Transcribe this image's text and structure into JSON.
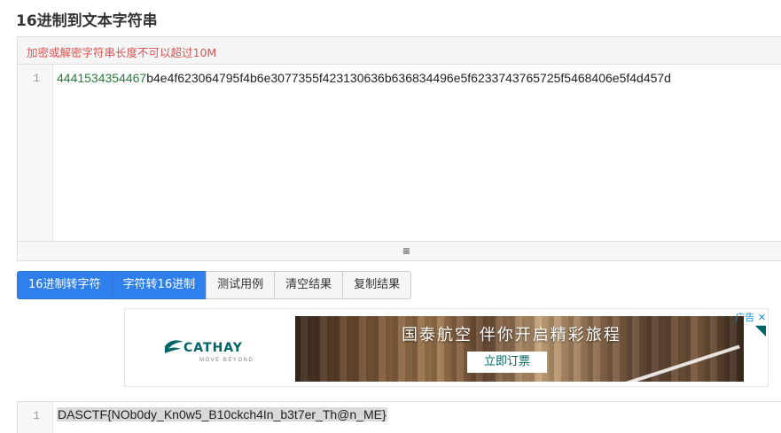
{
  "page": {
    "title": "16进制到文本字符串"
  },
  "editor": {
    "hint": "加密或解密字符串长度不可以超过10M",
    "line_number": "1",
    "input_value_numeric": "4441534354467",
    "input_value_rest": "b4e4f623064795f4b6e3077355f423130636b636834496e5f6233743765725f5468406e5f4d457d",
    "resize_icon": "≡"
  },
  "buttons": {
    "hex_to_text": "16进制转字符",
    "text_to_hex": "字符转16进制",
    "test_case": "测试用例",
    "clear_result": "清空结果",
    "copy_result": "复制结果"
  },
  "ad": {
    "logo": "CATHAY",
    "logo_sub": "MOVE BEYOND",
    "headline": "国泰航空 伴你开启精彩旅程",
    "cta": "立即订票",
    "corner_label": "广告",
    "close_icon": "close-icon"
  },
  "result": {
    "line_number": "1",
    "value": "DASCTF{NOb0dy_Kn0w5_B10ckch4In_b3t7er_Th@n_ME}"
  },
  "colors": {
    "primary": "#2f80ed",
    "hint_red": "#d9534f",
    "brand_teal": "#006564"
  }
}
